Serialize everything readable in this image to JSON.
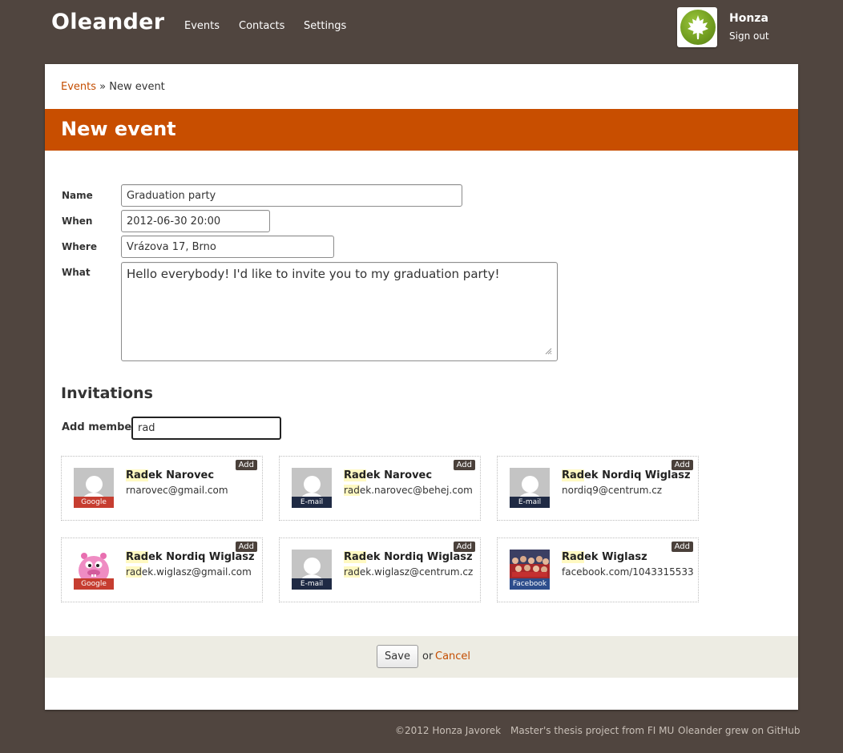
{
  "app": {
    "name": "Oleander",
    "nav": [
      "Events",
      "Contacts",
      "Settings"
    ],
    "user": {
      "name": "Honza",
      "signout": "Sign out"
    }
  },
  "breadcrumb": {
    "parent": "Events",
    "separator": "»",
    "current": "New event"
  },
  "page_title": "New event",
  "form": {
    "name": {
      "label": "Name",
      "value": "Graduation party"
    },
    "when": {
      "label": "When",
      "value": "2012-06-30 20:00"
    },
    "where": {
      "label": "Where",
      "value": "Vrázova 17, Brno"
    },
    "what": {
      "label": "What",
      "value": "Hello everybody! I'd like to invite you to my graduation party!"
    }
  },
  "invitations": {
    "heading": "Invitations",
    "add_member_label": "Add member",
    "search_value": "rad",
    "add_label": "Add",
    "results": [
      {
        "name_hl": "Rad",
        "name_rest": "ek Narovec",
        "detail_hl": "",
        "detail_rest": "rnarovec@gmail.com",
        "source": "Google",
        "avatar": "default"
      },
      {
        "name_hl": "Rad",
        "name_rest": "ek Narovec",
        "detail_hl": "rad",
        "detail_rest": "ek.narovec@behej.com",
        "source": "E-mail",
        "avatar": "default"
      },
      {
        "name_hl": "Rad",
        "name_rest": "ek Nordiq Wiglasz",
        "detail_hl": "",
        "detail_rest": "nordiq9@centrum.cz",
        "source": "E-mail",
        "avatar": "default"
      },
      {
        "name_hl": "Rad",
        "name_rest": "ek Nordiq Wiglasz",
        "detail_hl": "rad",
        "detail_rest": "ek.wiglasz@gmail.com",
        "source": "Google",
        "avatar": "pink-monster"
      },
      {
        "name_hl": "Rad",
        "name_rest": "ek Nordiq Wiglasz",
        "detail_hl": "rad",
        "detail_rest": "ek.wiglasz@centrum.cz",
        "source": "E-mail",
        "avatar": "default"
      },
      {
        "name_hl": "Rad",
        "name_rest": "ek Wiglasz",
        "detail_hl": "",
        "detail_rest": "facebook.com/1043315533",
        "source": "Facebook",
        "avatar": "group-photo"
      }
    ]
  },
  "actions": {
    "save": "Save",
    "or": "or",
    "cancel": "Cancel"
  },
  "footer": [
    "©2012 Honza Javorek",
    "Master's thesis project from FI MU",
    "Oleander grew on GitHub"
  ],
  "colors": {
    "background": "#50453f",
    "accent": "#c84e00",
    "link": "#c44d00",
    "highlight": "#fff9c2"
  }
}
